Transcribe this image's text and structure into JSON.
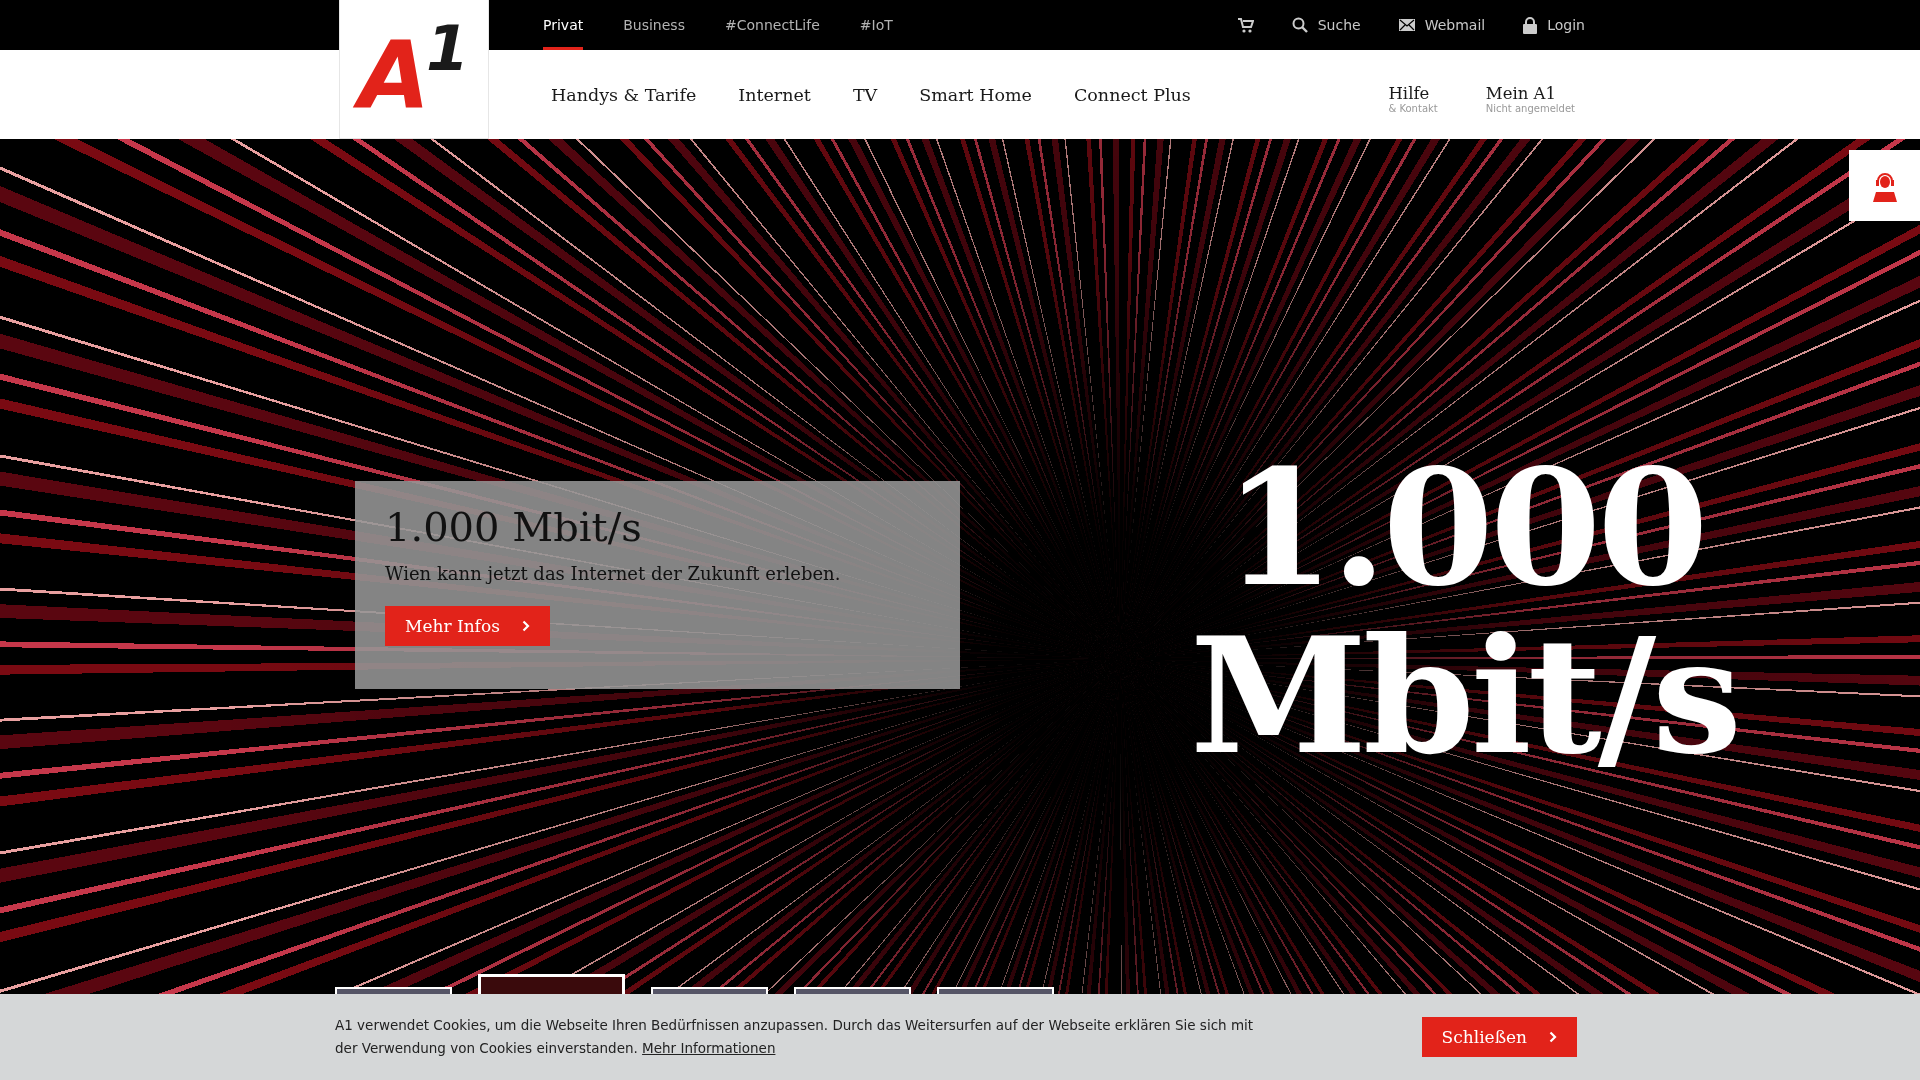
{
  "logo": {
    "letter": "A",
    "digit": "1"
  },
  "top_tabs": [
    {
      "label": "Privat",
      "selected": true
    },
    {
      "label": "Business",
      "selected": false
    },
    {
      "label": "#ConnectLife",
      "selected": false
    },
    {
      "label": "#IoT",
      "selected": false
    }
  ],
  "top_links": [
    {
      "kind": "cart"
    },
    {
      "kind": "search",
      "label": "Suche"
    },
    {
      "kind": "mail",
      "label": "Webmail"
    },
    {
      "kind": "lock",
      "label": "Login"
    }
  ],
  "main_nav": [
    "Handys & Tarife",
    "Internet",
    "TV",
    "Smart Home",
    "Connect Plus"
  ],
  "service_nav": [
    {
      "label": "Hilfe",
      "sublabel": "& Kontakt"
    },
    {
      "label": "Mein A1",
      "sublabel": "Nicht angemeldet"
    }
  ],
  "hero": {
    "title": "1.000 Mbit/s",
    "text": "Wien kann jetzt das Internet der Zukunft erleben.",
    "button": "Mehr Infos",
    "graphic_lines": [
      "1.000",
      "Mbit/s"
    ]
  },
  "thumbnails": [
    {
      "selected": false
    },
    {
      "selected": true
    },
    {
      "selected": false
    },
    {
      "selected": false
    },
    {
      "selected": false
    }
  ],
  "cookie_bar": {
    "text": "A1 verwendet Cookies, um die Webseite Ihren Bedürfnissen anzupassen. Durch das Weitersurfen auf der Webseite erklären Sie sich mit der Verwendung von Cookies einverstanden.",
    "link": "Mehr Informationen",
    "button": "Schließen"
  }
}
